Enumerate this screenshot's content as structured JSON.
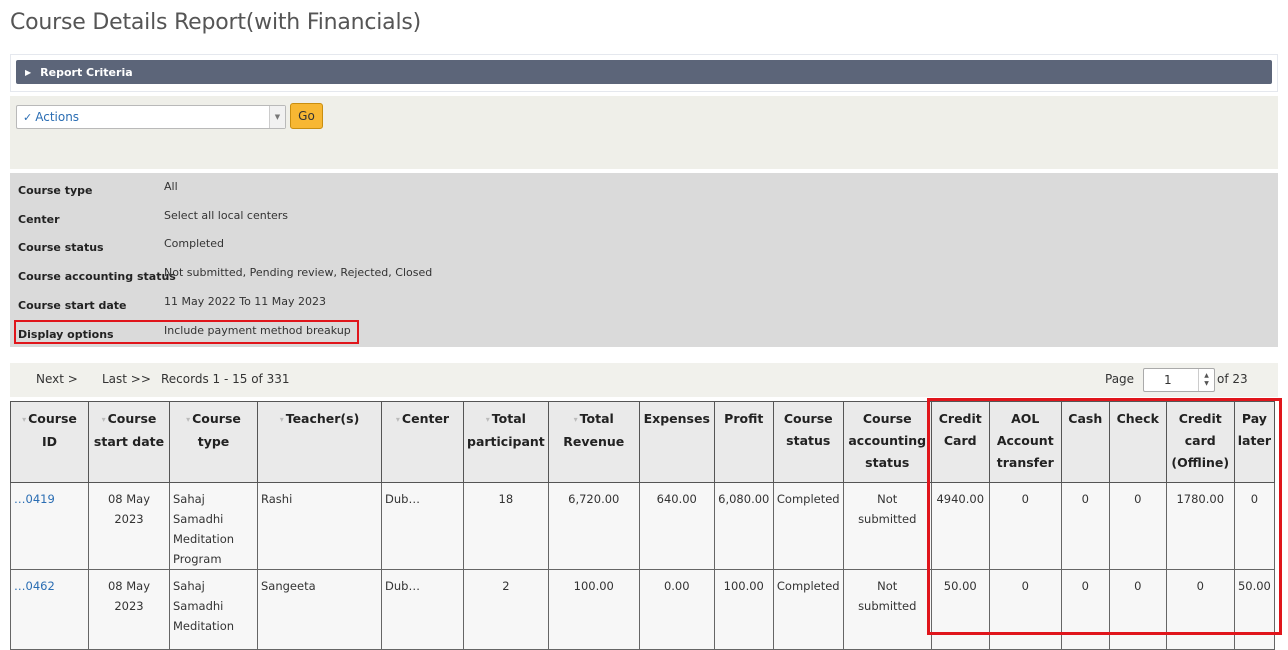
{
  "page": {
    "title": "Course Details Report(with Financials)"
  },
  "criteria": {
    "label": "Report Criteria"
  },
  "actions": {
    "select_value": "Actions",
    "go_label": "Go"
  },
  "summary": {
    "rows": [
      {
        "label": "Course type",
        "value": "All"
      },
      {
        "label": "Center",
        "value": "Select all local centers"
      },
      {
        "label": "Course status",
        "value": "Completed"
      },
      {
        "label": "Course accounting status",
        "value": "Not submitted, Pending review, Rejected, Closed"
      },
      {
        "label": "Course start date",
        "value": "11 May 2022 To 11 May 2023"
      },
      {
        "label": "Display options",
        "value": "Include payment method breakup"
      }
    ]
  },
  "pager": {
    "next": "Next >",
    "last": "Last >>",
    "records": "Records 1 - 15 of 331",
    "page_label": "Page",
    "page_value": "1",
    "of_total": "of 23"
  },
  "table": {
    "headers": [
      "Course ID",
      "Course start date",
      "Course type",
      "Teacher(s)",
      "Center",
      "Total participant",
      "Total Revenue",
      "Expenses",
      "Profit",
      "Course status",
      "Course accounting status",
      "Credit Card",
      "AOL Account transfer",
      "Cash",
      "Check",
      "Credit card (Offline)",
      "Pay later"
    ],
    "rows": [
      {
        "course_id": "…0419",
        "start_date": "08 May 2023",
        "type": "Sahaj Samadhi Meditation Program",
        "teacher": "Rashi",
        "center": "Dub…",
        "participants": "18",
        "revenue": "6,720.00",
        "expenses": "640.00",
        "profit": "6,080.00",
        "status": "Completed",
        "accounting": "Not submitted",
        "credit_card": "4940.00",
        "aol_transfer": "0",
        "cash": "0",
        "check": "0",
        "credit_offline": "1780.00",
        "pay_later": "0"
      },
      {
        "course_id": "…0462",
        "start_date": "08 May 2023",
        "type": "Sahaj Samadhi Meditation",
        "teacher": "Sangeeta",
        "center": "Dub…",
        "participants": "2",
        "revenue": "100.00",
        "expenses": "0.00",
        "profit": "100.00",
        "status": "Completed",
        "accounting": "Not submitted",
        "credit_card": "50.00",
        "aol_transfer": "0",
        "cash": "0",
        "check": "0",
        "credit_offline": "0",
        "pay_later": "50.00"
      }
    ]
  },
  "colors": {
    "criteria_bar": "#5c6579",
    "go_button": "#f7b733",
    "highlight": "#e0151b",
    "link": "#2a6db3"
  },
  "icons": {
    "criteria_toggle": "caret-right-icon",
    "actions": "check-circle-icon",
    "select_arrow": "chevron-down-icon",
    "page_spinner": "spinner-icon"
  }
}
